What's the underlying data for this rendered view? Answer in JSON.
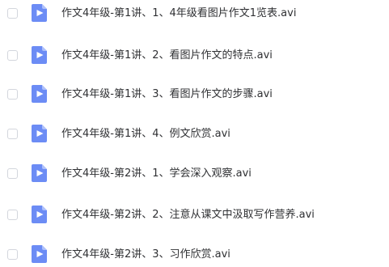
{
  "files": [
    {
      "name": "作文4年级-第1讲、1、4年级看图片作文1览表.avi",
      "icon": "video-file-icon"
    },
    {
      "name": "作文4年级-第1讲、2、看图片作文的特点.avi",
      "icon": "video-file-icon"
    },
    {
      "name": "作文4年级-第1讲、3、看图片作文的步骤.avi",
      "icon": "video-file-icon"
    },
    {
      "name": "作文4年级-第1讲、4、例文欣赏.avi",
      "icon": "video-file-icon"
    },
    {
      "name": "作文4年级-第2讲、1、学会深入观察.avi",
      "icon": "video-file-icon"
    },
    {
      "name": "作文4年级-第2讲、2、注意从课文中汲取写作营养.avi",
      "icon": "video-file-icon"
    },
    {
      "name": "作文4年级-第2讲、3、习作欣赏.avi",
      "icon": "video-file-icon"
    }
  ],
  "colors": {
    "icon_background": "#6c8cf5",
    "icon_glyph": "#ffffff",
    "text": "#2f3033",
    "checkbox_border": "#d3d6dd"
  }
}
